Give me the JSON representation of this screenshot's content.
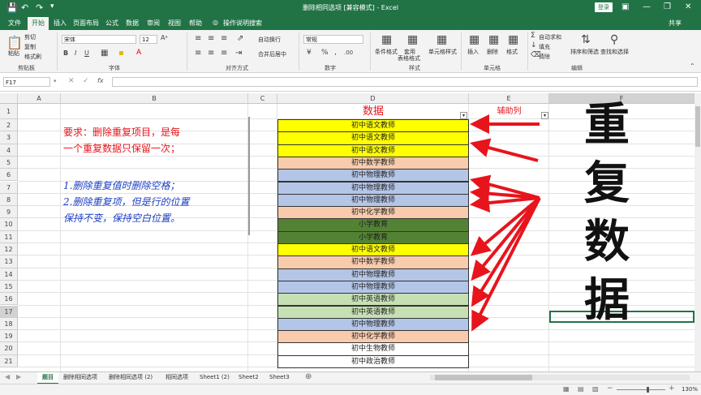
{
  "title_bar": {
    "title": "删除相同选项 [兼容模式] - Excel",
    "login": "登录"
  },
  "menu_tabs": [
    "文件",
    "开始",
    "插入",
    "页面布局",
    "公式",
    "数据",
    "审阅",
    "视图",
    "帮助"
  ],
  "tell_me": "操作说明搜索",
  "share": "共享",
  "ribbon": {
    "clipboard": {
      "paste": "粘贴",
      "cut": "剪切",
      "copy": "复制",
      "format_painter": "格式刷",
      "label": "剪贴板"
    },
    "font": {
      "name": "宋体",
      "size": "12",
      "label": "字体"
    },
    "alignment": {
      "wrap": "自动换行",
      "merge": "合并后居中",
      "label": "对齐方式"
    },
    "number": {
      "format": "常规",
      "label": "数字"
    },
    "styles": {
      "conditional": "条件格式",
      "table": "套用\n表格格式",
      "cell_styles": "单元格样式",
      "label": "样式"
    },
    "cells": {
      "insert": "插入",
      "delete": "删除",
      "format": "格式",
      "label": "单元格"
    },
    "editing": {
      "autosum": "自动求和",
      "fill": "填充",
      "clear": "清除",
      "sort": "排序和筛选",
      "find": "查找和选择",
      "label": "编辑"
    }
  },
  "name_box": "F17",
  "fx": "fx",
  "columns": [
    "A",
    "B",
    "C",
    "D",
    "E",
    "F"
  ],
  "rows": [
    "1",
    "2",
    "3",
    "4",
    "5",
    "6",
    "7",
    "8",
    "9",
    "10",
    "11",
    "12",
    "13",
    "14",
    "15",
    "16",
    "17",
    "18",
    "19",
    "20",
    "21"
  ],
  "header_d": "数据",
  "header_e": "辅助列",
  "data_cells": [
    {
      "text": "初中语文教师",
      "color": "#ffff00"
    },
    {
      "text": "初中语文教师",
      "color": "#ffff00"
    },
    {
      "text": "初中语文教师",
      "color": "#ffff00"
    },
    {
      "text": "初中数学教师",
      "color": "#f8cbad"
    },
    {
      "text": "初中物理教师",
      "color": "#b4c6e7"
    },
    {
      "text": "初中物理教师",
      "color": "#b4c6e7"
    },
    {
      "text": "初中物理教师",
      "color": "#b4c6e7"
    },
    {
      "text": "初中化学教师",
      "color": "#f8cbad"
    },
    {
      "text": "小学教育",
      "color": "#548235"
    },
    {
      "text": "小学教育",
      "color": "#548235"
    },
    {
      "text": "初中语文教师",
      "color": "#ffff00"
    },
    {
      "text": "初中数学教师",
      "color": "#f8cbad"
    },
    {
      "text": "初中物理教师",
      "color": "#b4c6e7"
    },
    {
      "text": "初中物理教师",
      "color": "#b4c6e7"
    },
    {
      "text": "初中英语教师",
      "color": "#c6e0b4"
    },
    {
      "text": "初中英语教师",
      "color": "#c6e0b4"
    },
    {
      "text": "初中物理教师",
      "color": "#b4c6e7"
    },
    {
      "text": "初中化学教师",
      "color": "#f8cbad"
    },
    {
      "text": "初中生物教师",
      "color": "#ffffff"
    },
    {
      "text": "初中政治教师",
      "color": "#ffffff"
    }
  ],
  "requirement": {
    "line1": "要求：删除重复项目，是每",
    "line2": "一个重复数据只保留一次；",
    "line3": "1.删除重复值时删除空格；",
    "line4": "2.删除重复项，但是行的位置",
    "line5": "保持不变，保持空白位置。"
  },
  "big_label": [
    "重",
    "复",
    "数",
    "据"
  ],
  "sheet_tabs": [
    "题目",
    "删除相同选项",
    "删除相同选项 (2)",
    "相同选项",
    "Sheet1 (2)",
    "Sheet2",
    "Sheet3"
  ],
  "zoom": "130%",
  "colors": {
    "excel_green": "#217346",
    "red": "#e8141c",
    "blue": "#1c3fc4"
  }
}
